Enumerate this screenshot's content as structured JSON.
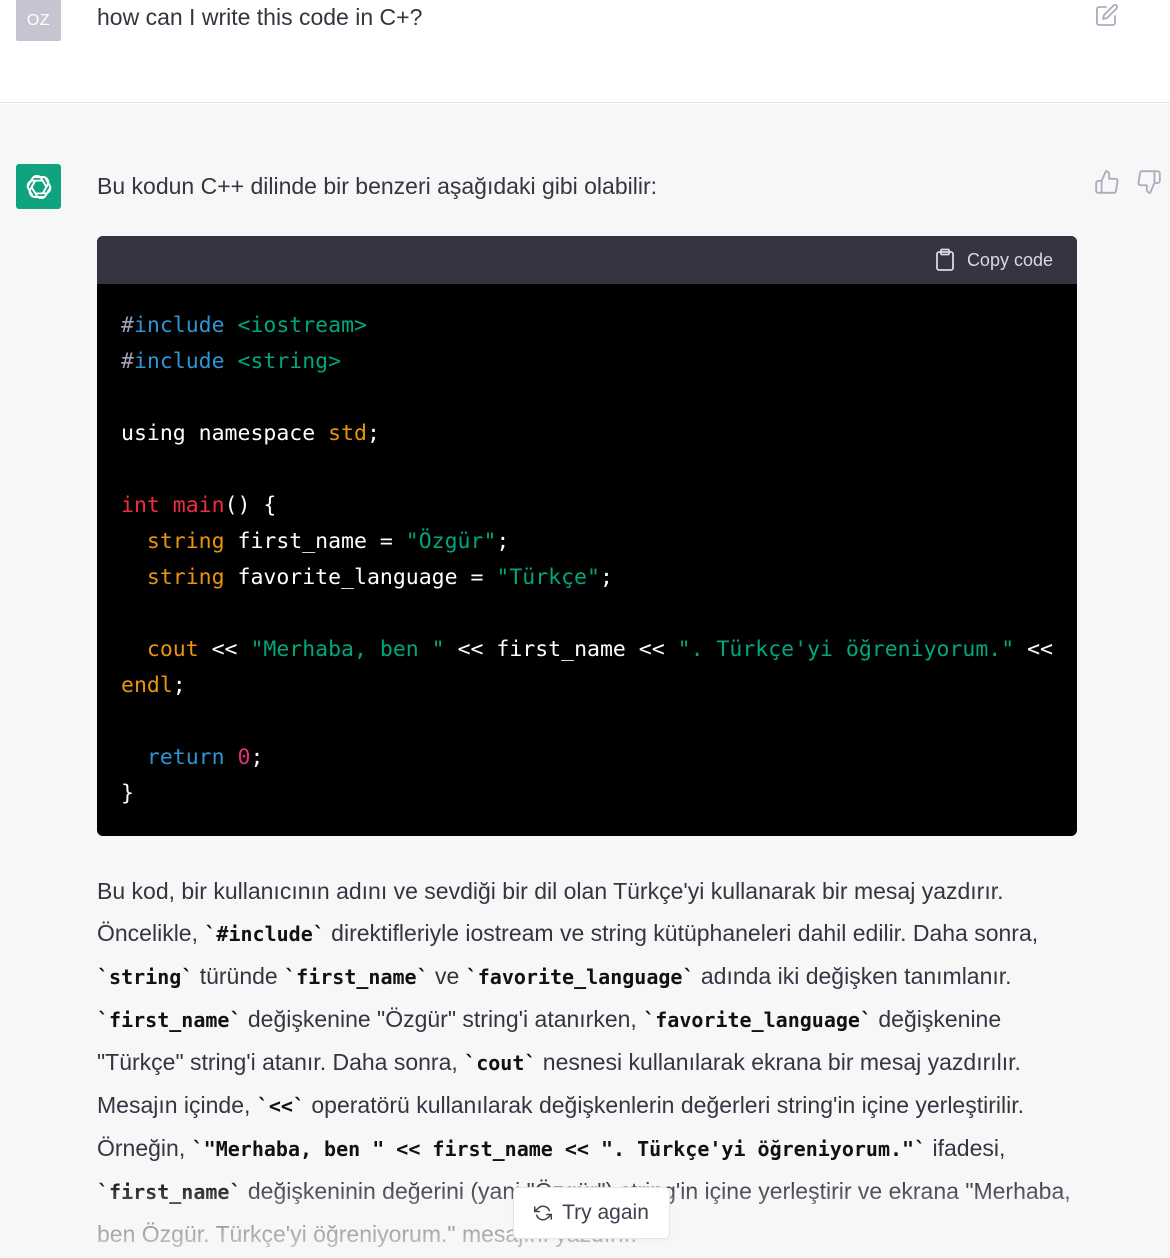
{
  "user_message": {
    "avatar_initials": "OZ",
    "text": "how can I write this code in C+?",
    "edit_icon": "edit-icon"
  },
  "assistant_message": {
    "intro": "Bu kodun C++ dilinde bir benzeri aşağıdaki gibi olabilir:",
    "feedback": {
      "thumbs_up_icon": "thumbs-up-icon",
      "thumbs_down_icon": "thumbs-down-icon"
    },
    "code_block": {
      "copy_label": "Copy code",
      "lines": [
        [
          [
            "meta",
            "#"
          ],
          [
            "kw",
            "include"
          ],
          [
            "plain",
            " "
          ],
          [
            "str",
            "<iostream>"
          ]
        ],
        [
          [
            "meta",
            "#"
          ],
          [
            "kw",
            "include"
          ],
          [
            "plain",
            " "
          ],
          [
            "str",
            "<string>"
          ]
        ],
        [],
        [
          [
            "plain",
            "using namespace "
          ],
          [
            "type",
            "std"
          ],
          [
            "plain",
            ";"
          ]
        ],
        [],
        [
          [
            "red",
            "int"
          ],
          [
            "plain",
            " "
          ],
          [
            "red",
            "main"
          ],
          [
            "plain",
            "() {"
          ]
        ],
        [
          [
            "plain",
            "  "
          ],
          [
            "type",
            "string"
          ],
          [
            "plain",
            " first_name = "
          ],
          [
            "str",
            "\"Özgür\""
          ],
          [
            "plain",
            ";"
          ]
        ],
        [
          [
            "plain",
            "  "
          ],
          [
            "type",
            "string"
          ],
          [
            "plain",
            " favorite_language = "
          ],
          [
            "str",
            "\"Türkçe\""
          ],
          [
            "plain",
            ";"
          ]
        ],
        [],
        [
          [
            "plain",
            "  "
          ],
          [
            "type",
            "cout"
          ],
          [
            "plain",
            " << "
          ],
          [
            "str",
            "\"Merhaba, ben \""
          ],
          [
            "plain",
            " << first_name << "
          ],
          [
            "str",
            "\". Türkçe'yi öğreniyorum.\""
          ],
          [
            "plain",
            " <<"
          ]
        ],
        [
          [
            "type",
            "endl"
          ],
          [
            "plain",
            ";"
          ]
        ],
        [],
        [
          [
            "plain",
            "  "
          ],
          [
            "kw",
            "return"
          ],
          [
            "plain",
            " "
          ],
          [
            "num",
            "0"
          ],
          [
            "plain",
            ";"
          ]
        ],
        [
          [
            "plain",
            "}"
          ]
        ]
      ]
    },
    "explanation": [
      [
        "t",
        "Bu kod, bir kullanıcının adını ve sevdiği bir dil olan Türkçe'yi kullanarak bir mesaj yazdırır. Öncelikle, "
      ],
      [
        "c",
        "`#include`"
      ],
      [
        "t",
        " direktifleriyle iostream ve string kütüphaneleri dahil edilir. Daha sonra, "
      ],
      [
        "c",
        "`string`"
      ],
      [
        "t",
        " türünde "
      ],
      [
        "c",
        "`first_name`"
      ],
      [
        "t",
        " ve "
      ],
      [
        "c",
        "`favorite_language`"
      ],
      [
        "t",
        " adında iki değişken tanımlanır. "
      ],
      [
        "c",
        "`first_name`"
      ],
      [
        "t",
        " değişkenine \"Özgür\" string'i atanırken, "
      ],
      [
        "c",
        "`favorite_language`"
      ],
      [
        "t",
        " değişkenine \"Türkçe\" string'i atanır. Daha sonra, "
      ],
      [
        "c",
        "`cout`"
      ],
      [
        "t",
        " nesnesi kullanılarak ekrana bir mesaj yazdırılır. Mesajın içinde, "
      ],
      [
        "c",
        "`<<`"
      ],
      [
        "t",
        " operatörü kullanılarak değişkenlerin değerleri string'in içine yerleştirilir. Örneğin, "
      ],
      [
        "c",
        "`\"Merhaba, ben \" << first_name << \". Türkçe'yi öğreniyorum.\"`"
      ],
      [
        "t",
        " ifadesi, "
      ],
      [
        "c",
        "`first_name`"
      ],
      [
        "t",
        " değişkeninin değerini (yani \"Özgür\") string'in içine yerleştirir ve ekrana \"Merhaba, ben Özgür. Türkçe'yi öğreniyorum.\" mesajını yazdırır."
      ]
    ]
  },
  "try_again": {
    "label": "Try again",
    "icon": "refresh-icon"
  }
}
